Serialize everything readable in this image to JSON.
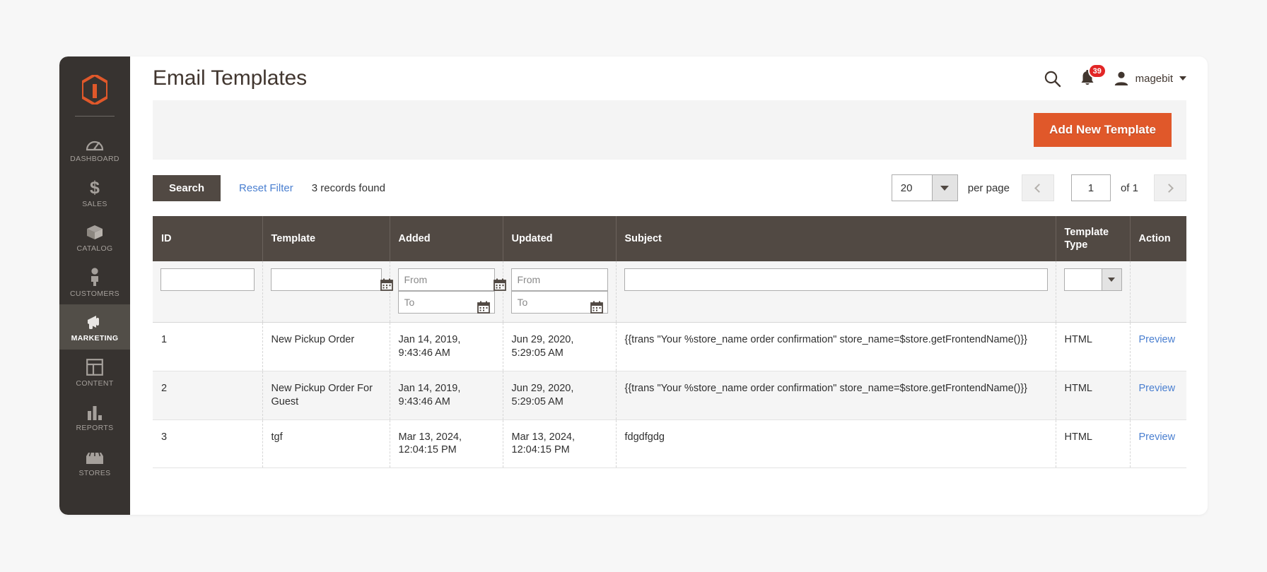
{
  "sidebar": {
    "logo": "magento-logo-icon",
    "items": [
      {
        "label": "DASHBOARD",
        "icon": "dashboard-icon",
        "active": false
      },
      {
        "label": "SALES",
        "icon": "dollar-icon",
        "active": false
      },
      {
        "label": "CATALOG",
        "icon": "box-icon",
        "active": false
      },
      {
        "label": "CUSTOMERS",
        "icon": "person-icon",
        "active": false
      },
      {
        "label": "MARKETING",
        "icon": "megaphone-icon",
        "active": true
      },
      {
        "label": "CONTENT",
        "icon": "layout-icon",
        "active": false
      },
      {
        "label": "REPORTS",
        "icon": "bar-chart-icon",
        "active": false
      },
      {
        "label": "STORES",
        "icon": "storefront-icon",
        "active": false
      }
    ]
  },
  "header": {
    "title": "Email Templates",
    "search_icon": "search-icon",
    "notifications": {
      "icon": "bell-icon",
      "count": "39",
      "color": "#e22626"
    },
    "user": {
      "avatar_icon": "user-avatar-icon",
      "name": "magebit",
      "caret": "chevron-down-icon"
    }
  },
  "action_panel": {
    "add_new_template_label": "Add New Template",
    "accent_color": "#e0582a"
  },
  "toolbar": {
    "search_label": "Search",
    "reset_filter_label": "Reset Filter",
    "records_found": "3 records found",
    "per_page_value": "20",
    "per_page_label": "per page",
    "current_page": "1",
    "of_label": "of 1",
    "prev_icon": "chevron-left-icon",
    "next_icon": "chevron-right-icon"
  },
  "grid": {
    "columns": [
      {
        "key": "id",
        "label": "ID"
      },
      {
        "key": "template",
        "label": "Template"
      },
      {
        "key": "added",
        "label": "Added"
      },
      {
        "key": "updated",
        "label": "Updated"
      },
      {
        "key": "subject",
        "label": "Subject"
      },
      {
        "key": "template_type",
        "label": "Template Type"
      },
      {
        "key": "action",
        "label": "Action"
      }
    ],
    "filters": {
      "id": "",
      "template": "",
      "added_from_placeholder": "From",
      "added_to_placeholder": "To",
      "updated_from_placeholder": "From",
      "updated_to_placeholder": "To",
      "subject": "",
      "template_type_selected": "",
      "calendar_icon": "calendar-icon"
    },
    "rows": [
      {
        "id": "1",
        "template": "New Pickup Order",
        "added": "Jan 14, 2019, 9:43:46 AM",
        "updated": "Jun 29, 2020, 5:29:05 AM",
        "subject": "{{trans \"Your %store_name order confirmation\" store_name=$store.getFrontendName()}}",
        "template_type": "HTML",
        "action": "Preview"
      },
      {
        "id": "2",
        "template": "New Pickup Order For Guest",
        "added": "Jan 14, 2019, 9:43:46 AM",
        "updated": "Jun 29, 2020, 5:29:05 AM",
        "subject": "{{trans \"Your %store_name order confirmation\" store_name=$store.getFrontendName()}}",
        "template_type": "HTML",
        "action": "Preview"
      },
      {
        "id": "3",
        "template": "tgf",
        "added": "Mar 13, 2024, 12:04:15 PM",
        "updated": "Mar 13, 2024, 12:04:15 PM",
        "subject": "fdgdfgdg",
        "template_type": "HTML",
        "action": "Preview"
      }
    ]
  }
}
